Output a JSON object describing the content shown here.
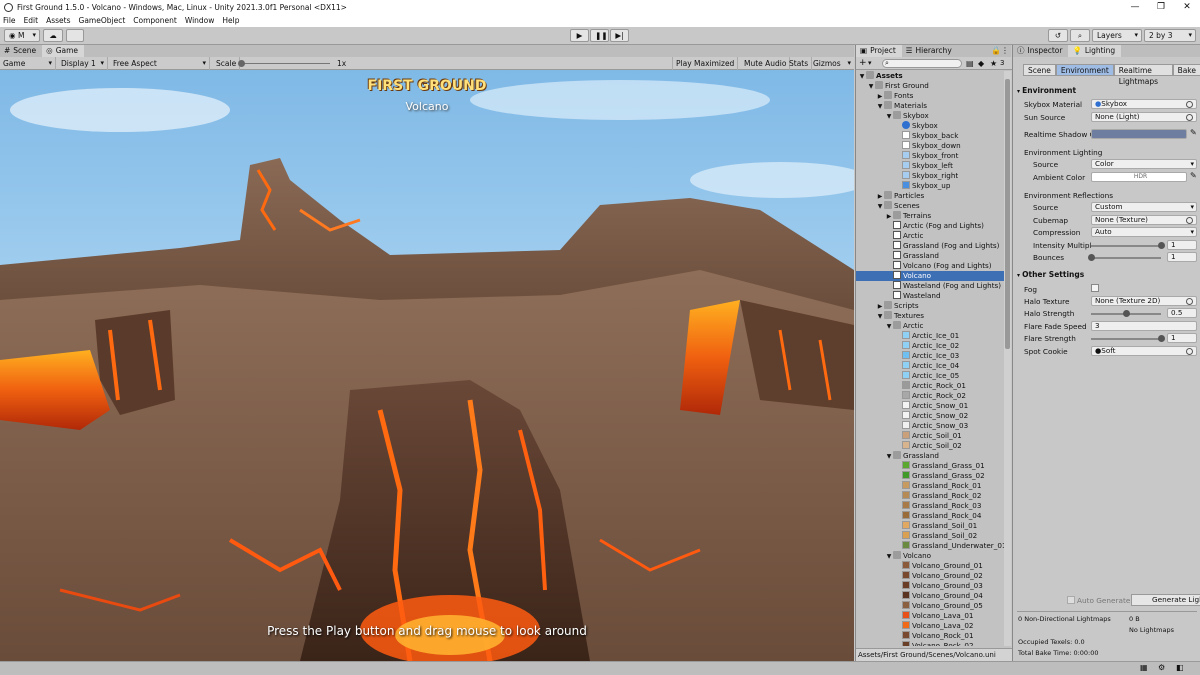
{
  "window": {
    "title": "First Ground 1.5.0 - Volcano - Windows, Mac, Linux - Unity 2021.3.0f1 Personal <DX11>",
    "minimize": "—",
    "maximize": "❐",
    "close": "✕"
  },
  "menu": [
    "File",
    "Edit",
    "Assets",
    "GameObject",
    "Component",
    "Window",
    "Help"
  ],
  "toolbar": {
    "account": "M",
    "layers": "Layers",
    "layout": "2 by 3"
  },
  "game_panel": {
    "tabs": [
      "Scene",
      "Game"
    ],
    "bar": {
      "mode": "Game",
      "display": "Display 1",
      "aspect": "Free Aspect",
      "scale_label": "Scale",
      "scale_value": "1x",
      "play_maximized": "Play Maximized",
      "mute_audio": "Mute Audio",
      "stats": "Stats",
      "gizmos": "Gizmos"
    },
    "overlay": {
      "title": "FIRST GROUND",
      "subtitle": "Volcano",
      "hint": "Press the Play button and drag mouse to look around"
    }
  },
  "project_panel": {
    "tabs": [
      "Project",
      "Hierarchy"
    ],
    "add_label": "+",
    "count": "3",
    "path": "Assets/First Ground/Scenes/Volcano.uni",
    "tree": [
      {
        "label": "Assets",
        "depth": 0,
        "type": "folder",
        "expanded": true,
        "bold": true
      },
      {
        "label": "First Ground",
        "depth": 1,
        "type": "folder",
        "expanded": true
      },
      {
        "label": "Fonts",
        "depth": 2,
        "type": "folder",
        "expanded": false
      },
      {
        "label": "Materials",
        "depth": 2,
        "type": "folder",
        "expanded": true
      },
      {
        "label": "Skybox",
        "depth": 3,
        "type": "folder",
        "expanded": true
      },
      {
        "label": "Skybox",
        "depth": 4,
        "type": "material",
        "color": "#2f6fd0"
      },
      {
        "label": "Skybox_back",
        "depth": 4,
        "type": "texture",
        "color": "#ffffff"
      },
      {
        "label": "Skybox_down",
        "depth": 4,
        "type": "texture",
        "color": "#ffffff"
      },
      {
        "label": "Skybox_front",
        "depth": 4,
        "type": "texture",
        "color": "#a6cdf0"
      },
      {
        "label": "Skybox_left",
        "depth": 4,
        "type": "texture",
        "color": "#a6cdf0"
      },
      {
        "label": "Skybox_right",
        "depth": 4,
        "type": "texture",
        "color": "#a6cdf0"
      },
      {
        "label": "Skybox_up",
        "depth": 4,
        "type": "texture",
        "color": "#4a8fe0"
      },
      {
        "label": "Particles",
        "depth": 2,
        "type": "folder",
        "expanded": false
      },
      {
        "label": "Scenes",
        "depth": 2,
        "type": "folder",
        "expanded": true
      },
      {
        "label": "Terrains",
        "depth": 3,
        "type": "folder",
        "expanded": false
      },
      {
        "label": "Arctic (Fog and Lights)",
        "depth": 3,
        "type": "scene"
      },
      {
        "label": "Arctic",
        "depth": 3,
        "type": "scene"
      },
      {
        "label": "Grassland (Fog and Lights)",
        "depth": 3,
        "type": "scene"
      },
      {
        "label": "Grassland",
        "depth": 3,
        "type": "scene"
      },
      {
        "label": "Volcano (Fog and Lights)",
        "depth": 3,
        "type": "scene"
      },
      {
        "label": "Volcano",
        "depth": 3,
        "type": "scene",
        "selected": true
      },
      {
        "label": "Wasteland (Fog and Lights)",
        "depth": 3,
        "type": "scene"
      },
      {
        "label": "Wasteland",
        "depth": 3,
        "type": "scene"
      },
      {
        "label": "Scripts",
        "depth": 2,
        "type": "folder",
        "expanded": false
      },
      {
        "label": "Textures",
        "depth": 2,
        "type": "folder",
        "expanded": true
      },
      {
        "label": "Arctic",
        "depth": 3,
        "type": "folder",
        "expanded": true
      },
      {
        "label": "Arctic_Ice_01",
        "depth": 4,
        "type": "texture",
        "color": "#8fd0f5"
      },
      {
        "label": "Arctic_Ice_02",
        "depth": 4,
        "type": "texture",
        "color": "#8fd0f5"
      },
      {
        "label": "Arctic_Ice_03",
        "depth": 4,
        "type": "texture",
        "color": "#6fc0f0"
      },
      {
        "label": "Arctic_Ice_04",
        "depth": 4,
        "type": "texture",
        "color": "#8fd0f5"
      },
      {
        "label": "Arctic_Ice_05",
        "depth": 4,
        "type": "texture",
        "color": "#8fd0f5"
      },
      {
        "label": "Arctic_Rock_01",
        "depth": 4,
        "type": "texture",
        "color": "#9a9a9a"
      },
      {
        "label": "Arctic_Rock_02",
        "depth": 4,
        "type": "texture",
        "color": "#a8a8a8"
      },
      {
        "label": "Arctic_Snow_01",
        "depth": 4,
        "type": "texture",
        "color": "#f4f4f4"
      },
      {
        "label": "Arctic_Snow_02",
        "depth": 4,
        "type": "texture",
        "color": "#f4f4f4"
      },
      {
        "label": "Arctic_Snow_03",
        "depth": 4,
        "type": "texture",
        "color": "#f0f0f0"
      },
      {
        "label": "Arctic_Soil_01",
        "depth": 4,
        "type": "texture",
        "color": "#c9a07a"
      },
      {
        "label": "Arctic_Soil_02",
        "depth": 4,
        "type": "texture",
        "color": "#d8b48e"
      },
      {
        "label": "Grassland",
        "depth": 3,
        "type": "folder",
        "expanded": true
      },
      {
        "label": "Grassland_Grass_01",
        "depth": 4,
        "type": "texture",
        "color": "#5aa830"
      },
      {
        "label": "Grassland_Grass_02",
        "depth": 4,
        "type": "texture",
        "color": "#3f9a2a"
      },
      {
        "label": "Grassland_Rock_01",
        "depth": 4,
        "type": "texture",
        "color": "#c79a60"
      },
      {
        "label": "Grassland_Rock_02",
        "depth": 4,
        "type": "texture",
        "color": "#b68a55"
      },
      {
        "label": "Grassland_Rock_03",
        "depth": 4,
        "type": "texture",
        "color": "#a87a48"
      },
      {
        "label": "Grassland_Rock_04",
        "depth": 4,
        "type": "texture",
        "color": "#9a6c3a"
      },
      {
        "label": "Grassland_Soil_01",
        "depth": 4,
        "type": "texture",
        "color": "#e0a860"
      },
      {
        "label": "Grassland_Soil_02",
        "depth": 4,
        "type": "texture",
        "color": "#d8a050"
      },
      {
        "label": "Grassland_Underwater_01",
        "depth": 4,
        "type": "texture",
        "color": "#6a8a40"
      },
      {
        "label": "Volcano",
        "depth": 3,
        "type": "folder",
        "expanded": true
      },
      {
        "label": "Volcano_Ground_01",
        "depth": 4,
        "type": "texture",
        "color": "#8a5a3a"
      },
      {
        "label": "Volcano_Ground_02",
        "depth": 4,
        "type": "texture",
        "color": "#7a4a2e"
      },
      {
        "label": "Volcano_Ground_03",
        "depth": 4,
        "type": "texture",
        "color": "#6a3e26"
      },
      {
        "label": "Volcano_Ground_04",
        "depth": 4,
        "type": "texture",
        "color": "#5a3420"
      },
      {
        "label": "Volcano_Ground_05",
        "depth": 4,
        "type": "texture",
        "color": "#8a6040"
      },
      {
        "label": "Volcano_Lava_01",
        "depth": 4,
        "type": "texture",
        "color": "#e8501a"
      },
      {
        "label": "Volcano_Lava_02",
        "depth": 4,
        "type": "texture",
        "color": "#f06a1a"
      },
      {
        "label": "Volcano_Rock_01",
        "depth": 4,
        "type": "texture",
        "color": "#7a4a30"
      },
      {
        "label": "Volcano_Rock_02",
        "depth": 4,
        "type": "texture",
        "color": "#6a4028"
      }
    ]
  },
  "inspector_panel": {
    "tabs": [
      "Inspector",
      "Lighting"
    ],
    "lighting_tabs": [
      "Scene",
      "Environment",
      "Realtime Lightmaps",
      "Bake"
    ],
    "environment": {
      "header": "Environment",
      "skybox_material_label": "Skybox Material",
      "skybox_material_value": "Skybox",
      "sun_source_label": "Sun Source",
      "sun_source_value": "None (Light)",
      "realtime_shadow_label": "Realtime Shadow C",
      "realtime_shadow_color": "#6e7ea0",
      "lighting_header": "Environment Lighting",
      "source_label": "Source",
      "source_value": "Color",
      "ambient_label": "Ambient Color",
      "ambient_value": "HDR",
      "reflections_header": "Environment Reflections",
      "refl_source_label": "Source",
      "refl_source_value": "Custom",
      "cubemap_label": "Cubemap",
      "cubemap_value": "None (Texture)",
      "compression_label": "Compression",
      "compression_value": "Auto",
      "intensity_label": "Intensity Multipl",
      "intensity_value": "1",
      "intensity_fraction": 1.0,
      "bounces_label": "Bounces",
      "bounces_value": "1",
      "bounces_fraction": 0.0
    },
    "other": {
      "header": "Other Settings",
      "fog_label": "Fog",
      "halo_texture_label": "Halo Texture",
      "halo_texture_value": "None (Texture 2D)",
      "halo_strength_label": "Halo Strength",
      "halo_strength_value": "0.5",
      "halo_strength_fraction": 0.5,
      "flare_fade_label": "Flare Fade Speed",
      "flare_fade_value": "3",
      "flare_strength_label": "Flare Strength",
      "flare_strength_value": "1",
      "flare_strength_fraction": 1.0,
      "spot_cookie_label": "Spot Cookie",
      "spot_cookie_value": "Soft"
    },
    "auto_generate": "Auto Generate",
    "generate_lighting": "Generate Ligh",
    "status": {
      "lightmaps": "0 Non-Directional Lightmaps",
      "size": "0 B",
      "no_lightmaps": "No Lightmaps",
      "occupied": "Occupied Texels: 0.0",
      "bake_time": "Total Bake Time: 0:00:00"
    }
  }
}
